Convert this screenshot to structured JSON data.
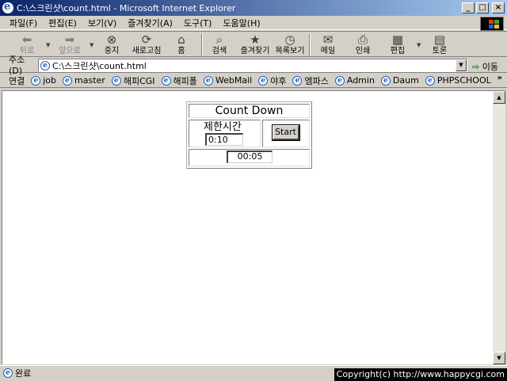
{
  "window": {
    "title": "C:\\스크린샷\\count.html - Microsoft Internet Explorer",
    "controls": {
      "minimize": "_",
      "maximize": "□",
      "close": "×"
    }
  },
  "menu": [
    "파일(F)",
    "편집(E)",
    "보기(V)",
    "즐겨찾기(A)",
    "도구(T)",
    "도움말(H)"
  ],
  "toolbar": {
    "back": "뒤로",
    "forward": "앞으로",
    "stop": "중지",
    "refresh": "새로고침",
    "home": "홈",
    "search": "검색",
    "favorites": "즐겨찾기",
    "history": "목록보기",
    "mail": "메일",
    "print": "인쇄",
    "edit": "편집",
    "discuss": "토론"
  },
  "address": {
    "label": "주소(D)",
    "value": "C:\\스크린샷\\count.html",
    "go": "이동"
  },
  "links": {
    "label": "연결",
    "items": [
      "job",
      "master",
      "해피CGI",
      "해피폴",
      "WebMail",
      "야후",
      "엠파스",
      "Admin",
      "Daum",
      "PHPSCHOOL"
    ],
    "more": "»"
  },
  "countdown": {
    "title": "Count Down",
    "limit_label": "제한시간",
    "limit_value": "0:10",
    "start_label": "Start",
    "time_value": "00:05"
  },
  "status": {
    "text": "완료",
    "copyright": "Copyright(c) http://www.happycgi.com"
  },
  "colors": {
    "titlebar_start": "#0a246a",
    "titlebar_end": "#a6caf0",
    "chrome": "#d4d0c8"
  }
}
